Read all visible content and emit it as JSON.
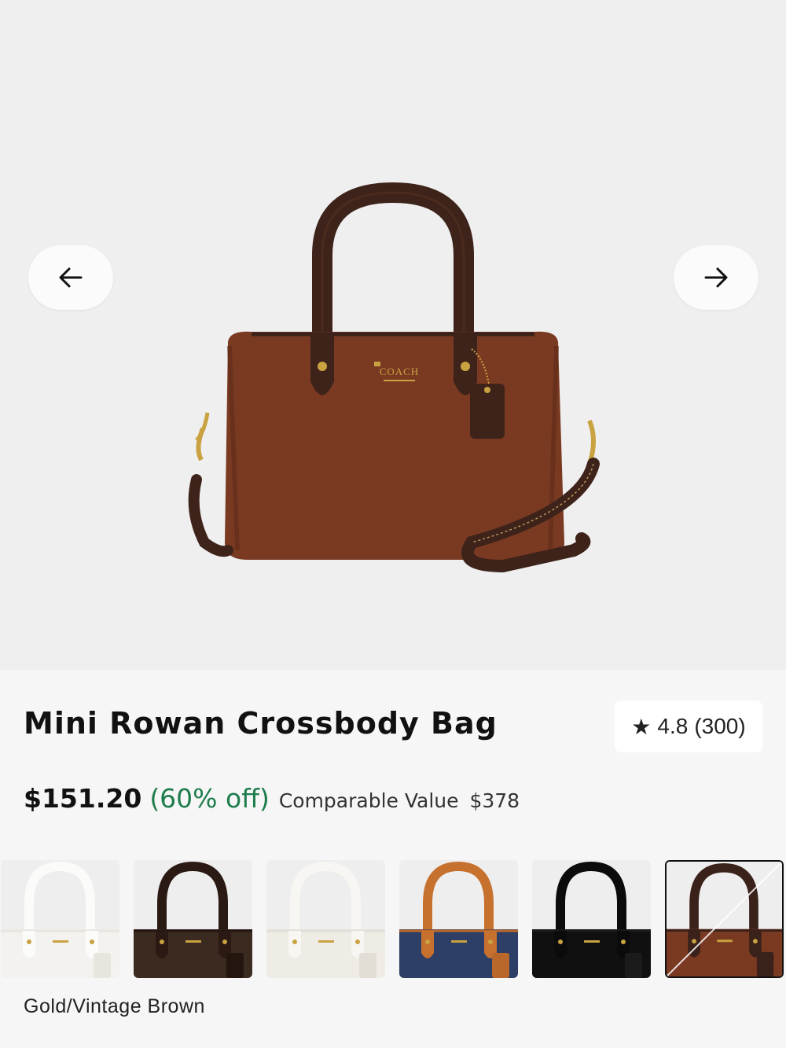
{
  "carousel": {
    "prev_icon": "arrow-left-icon",
    "next_icon": "arrow-right-icon",
    "bag_logo": "COACH"
  },
  "product": {
    "title": "Mini Rowan Crossbody Bag",
    "rating": {
      "icon": "star-icon",
      "value": "4.8",
      "count": "(300)"
    },
    "price": "$151.20",
    "discount": "(60% off)",
    "comparable_label": "Comparable Value",
    "comparable_price": "$378",
    "selected_color": "Gold/Vintage Brown"
  },
  "swatches": [
    {
      "body": "#f4f2ee",
      "handle": "#fbfbfa",
      "trim": "#e8e4de"
    },
    {
      "body": "#3b2a1f",
      "handle": "#2a1a13",
      "trim": "#24160f"
    },
    {
      "body": "#efece6",
      "handle": "#f7f6f3",
      "trim": "#e2ddd5"
    },
    {
      "body": "#2d3f66",
      "handle": "#c7712f",
      "trim": "#b9672b"
    },
    {
      "body": "#101010",
      "handle": "#0b0b0b",
      "trim": "#1b1b1b"
    },
    {
      "body": "#7a3a22",
      "handle": "#3a211a",
      "trim": "#3a211a",
      "selected": true,
      "unavailable": true
    }
  ],
  "colors": {
    "discount": "#1e7d4c",
    "bag_body": "#7a3a22",
    "bag_handle": "#3e231b",
    "hardware": "#c9a241"
  }
}
